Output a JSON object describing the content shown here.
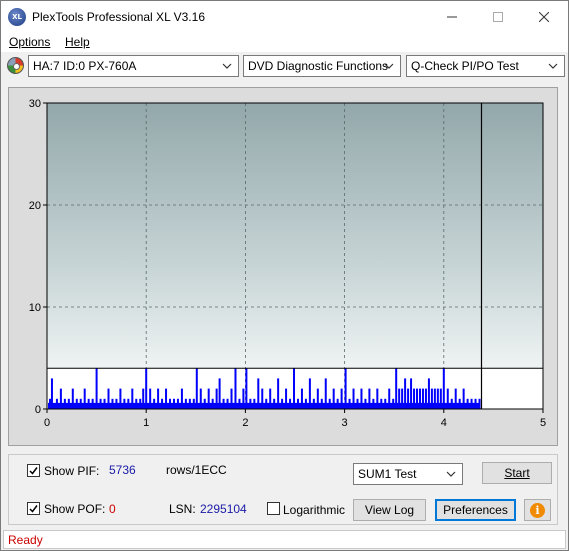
{
  "window": {
    "title": "PlexTools Professional XL V3.16",
    "app_icon_text": "XL"
  },
  "menu": {
    "items": [
      {
        "label": "Options"
      },
      {
        "label": "Help"
      }
    ]
  },
  "toolbar": {
    "drive_select": "HA:7 ID:0  PX-760A",
    "function_select": "DVD Diagnostic Functions",
    "test_select": "Q-Check PI/PO Test"
  },
  "chart_data": {
    "type": "bar",
    "x_range": [
      0,
      5
    ],
    "y_range": [
      0,
      30
    ],
    "x_ticks": [
      "0",
      "1",
      "2",
      "3",
      "4",
      "5"
    ],
    "y_ticks": [
      "0",
      "10",
      "20",
      "30"
    ],
    "grid": true,
    "threshold_line_y": 4,
    "end_marker_x": 4.38,
    "series": [
      {
        "color": "#0000ff",
        "points": [
          [
            0.03,
            1
          ],
          [
            0.05,
            3
          ],
          [
            0.1,
            1
          ],
          [
            0.14,
            2
          ],
          [
            0.18,
            1
          ],
          [
            0.22,
            1
          ],
          [
            0.26,
            2
          ],
          [
            0.3,
            1
          ],
          [
            0.34,
            1
          ],
          [
            0.38,
            2
          ],
          [
            0.42,
            1
          ],
          [
            0.46,
            1
          ],
          [
            0.5,
            4
          ],
          [
            0.54,
            1
          ],
          [
            0.58,
            1
          ],
          [
            0.62,
            2
          ],
          [
            0.66,
            1
          ],
          [
            0.7,
            1
          ],
          [
            0.74,
            2
          ],
          [
            0.78,
            1
          ],
          [
            0.82,
            1
          ],
          [
            0.86,
            2
          ],
          [
            0.9,
            1
          ],
          [
            0.94,
            1
          ],
          [
            0.97,
            2
          ],
          [
            1.0,
            4
          ],
          [
            1.04,
            2
          ],
          [
            1.08,
            1
          ],
          [
            1.12,
            2
          ],
          [
            1.16,
            1
          ],
          [
            1.2,
            2
          ],
          [
            1.24,
            1
          ],
          [
            1.28,
            1
          ],
          [
            1.32,
            1
          ],
          [
            1.36,
            2
          ],
          [
            1.4,
            1
          ],
          [
            1.44,
            1
          ],
          [
            1.48,
            1
          ],
          [
            1.51,
            4
          ],
          [
            1.55,
            2
          ],
          [
            1.59,
            1
          ],
          [
            1.63,
            2
          ],
          [
            1.67,
            1
          ],
          [
            1.71,
            2
          ],
          [
            1.74,
            3
          ],
          [
            1.78,
            1
          ],
          [
            1.82,
            1
          ],
          [
            1.86,
            2
          ],
          [
            1.9,
            4
          ],
          [
            1.94,
            1
          ],
          [
            1.98,
            2
          ],
          [
            2.01,
            4
          ],
          [
            2.05,
            1
          ],
          [
            2.09,
            1
          ],
          [
            2.13,
            3
          ],
          [
            2.17,
            2
          ],
          [
            2.21,
            1
          ],
          [
            2.25,
            2
          ],
          [
            2.29,
            1
          ],
          [
            2.33,
            3
          ],
          [
            2.37,
            1
          ],
          [
            2.41,
            2
          ],
          [
            2.45,
            1
          ],
          [
            2.49,
            4
          ],
          [
            2.53,
            1
          ],
          [
            2.57,
            2
          ],
          [
            2.61,
            1
          ],
          [
            2.65,
            3
          ],
          [
            2.69,
            1
          ],
          [
            2.73,
            2
          ],
          [
            2.77,
            1
          ],
          [
            2.81,
            3
          ],
          [
            2.85,
            1
          ],
          [
            2.89,
            2
          ],
          [
            2.93,
            1
          ],
          [
            2.97,
            2
          ],
          [
            3.01,
            4
          ],
          [
            3.05,
            1
          ],
          [
            3.09,
            2
          ],
          [
            3.13,
            1
          ],
          [
            3.17,
            2
          ],
          [
            3.21,
            1
          ],
          [
            3.25,
            2
          ],
          [
            3.29,
            1
          ],
          [
            3.33,
            2
          ],
          [
            3.37,
            1
          ],
          [
            3.41,
            1
          ],
          [
            3.45,
            2
          ],
          [
            3.49,
            1
          ],
          [
            3.52,
            4
          ],
          [
            3.55,
            2
          ],
          [
            3.58,
            2
          ],
          [
            3.61,
            3
          ],
          [
            3.64,
            2
          ],
          [
            3.67,
            3
          ],
          [
            3.7,
            2
          ],
          [
            3.73,
            2
          ],
          [
            3.76,
            2
          ],
          [
            3.79,
            2
          ],
          [
            3.82,
            2
          ],
          [
            3.85,
            3
          ],
          [
            3.88,
            2
          ],
          [
            3.91,
            2
          ],
          [
            3.94,
            2
          ],
          [
            3.97,
            2
          ],
          [
            4.0,
            4
          ],
          [
            4.04,
            2
          ],
          [
            4.08,
            1
          ],
          [
            4.12,
            2
          ],
          [
            4.16,
            1
          ],
          [
            4.2,
            2
          ],
          [
            4.24,
            1
          ],
          [
            4.28,
            1
          ],
          [
            4.32,
            1
          ],
          [
            4.36,
            1
          ]
        ]
      }
    ]
  },
  "controls": {
    "show_pif_label": "Show PIF:",
    "pif_value": "5736",
    "units_label": "rows/1ECC",
    "show_pof_label": "Show POF:",
    "pof_value": "0",
    "lsn_label": "LSN:",
    "lsn_value": "2295104",
    "logarithmic_label": "Logarithmic",
    "sum_select": "SUM1 Test",
    "start_button": "Start",
    "view_log_button": "View Log",
    "preferences_button": "Preferences",
    "info_icon_glyph": "i"
  },
  "status": {
    "text": "Ready"
  }
}
